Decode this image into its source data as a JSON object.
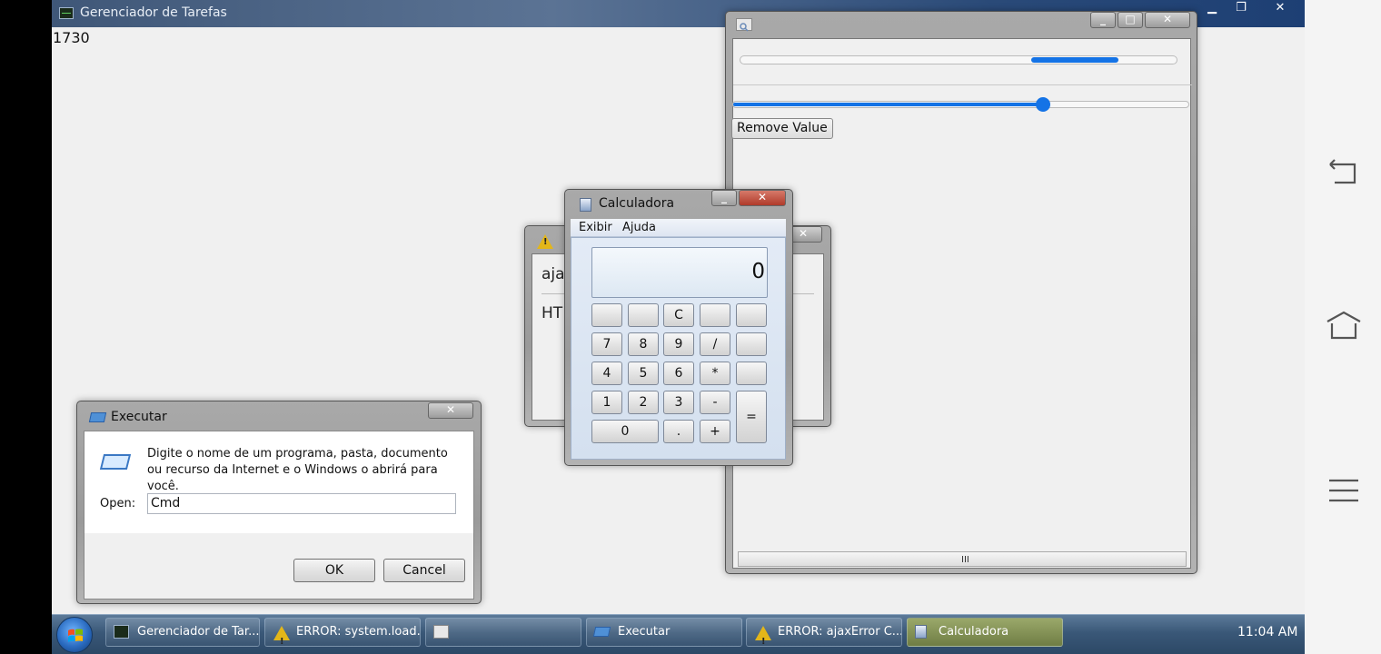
{
  "taskmanager": {
    "title": "Gerenciador de Tarefas",
    "counter": "1730"
  },
  "slider_window": {
    "progress_value": 0.2,
    "slider_value": 0.68,
    "remove_button": "Remove Value",
    "scroll_grip": "III"
  },
  "error_window": {
    "line1": "aja",
    "line2": "HT"
  },
  "calculator": {
    "title": "Calculadora",
    "menu": [
      "Exibir",
      "Ajuda"
    ],
    "display": "0",
    "keys": {
      "c": "C",
      "k7": "7",
      "k8": "8",
      "k9": "9",
      "div": "/",
      "k4": "4",
      "k5": "5",
      "k6": "6",
      "mul": "*",
      "k1": "1",
      "k2": "2",
      "k3": "3",
      "sub": "-",
      "k0": "0",
      "dot": ".",
      "add": "+",
      "eq": "="
    }
  },
  "run_dialog": {
    "title": "Executar",
    "description": "Digite o nome de um programa, pasta, documento ou recurso da Internet e o Windows o abrirá para você.",
    "open_label": "Open:",
    "input_value": "Cmd",
    "ok": "OK",
    "cancel": "Cancel"
  },
  "taskbar": {
    "items": [
      "Gerenciador de Tar...",
      "ERROR: system.load...",
      "",
      "Executar",
      "ERROR: ajaxError C...",
      "Calculadora"
    ],
    "clock": "11:04 AM"
  },
  "colors": {
    "accent": "#1473e6",
    "taskbar": "#3a5878",
    "warning": "#e3b619"
  }
}
